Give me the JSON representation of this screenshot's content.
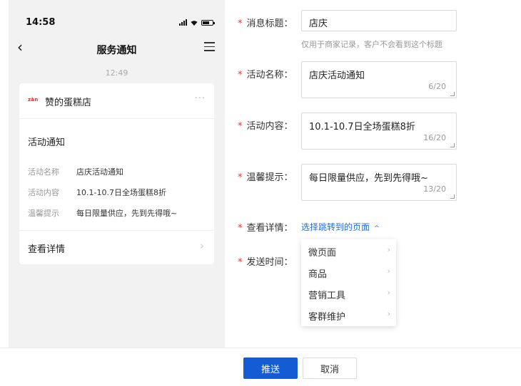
{
  "phone": {
    "status_time": "14:58",
    "nav_title": "服务通知",
    "message_time": "12:49",
    "card": {
      "shop_logo": "zàn",
      "shop_name": "赞的蛋糕店",
      "more": "···",
      "title": "活动通知",
      "rows": [
        {
          "key": "活动名称",
          "value": "店庆活动通知"
        },
        {
          "key": "活动内容",
          "value": "10.1-10.7日全场蛋糕8折"
        },
        {
          "key": "温馨提示",
          "value": "每日限量供应，先到先得哦~"
        }
      ],
      "footer_label": "查看详情"
    }
  },
  "form": {
    "required_mark": "*",
    "fields": {
      "subject": {
        "label": "消息标题：",
        "value": "店庆",
        "hint": "仅用于商家记录，客户不会看到这个标题"
      },
      "activity_name": {
        "label": "活动名称：",
        "value": "店庆活动通知",
        "count": "6/20"
      },
      "activity_content": {
        "label": "活动内容：",
        "value": "10.1-10.7日全场蛋糕8折",
        "count": "16/20"
      },
      "tip": {
        "label": "温馨提示：",
        "value": "每日限量供应，先到先得哦~",
        "count": "13/20"
      },
      "details": {
        "label": "查看详情：",
        "link": "选择跳转到的页面"
      },
      "send_time": {
        "label": "发送时间："
      }
    },
    "dropdown": [
      "微页面",
      "商品",
      "营销工具",
      "客群维护"
    ]
  },
  "footer": {
    "push_label": "推送",
    "cancel_label": "取消"
  },
  "colors": {
    "accent": "#155bd4",
    "link": "#1f6fde",
    "required": "#ee3333"
  }
}
